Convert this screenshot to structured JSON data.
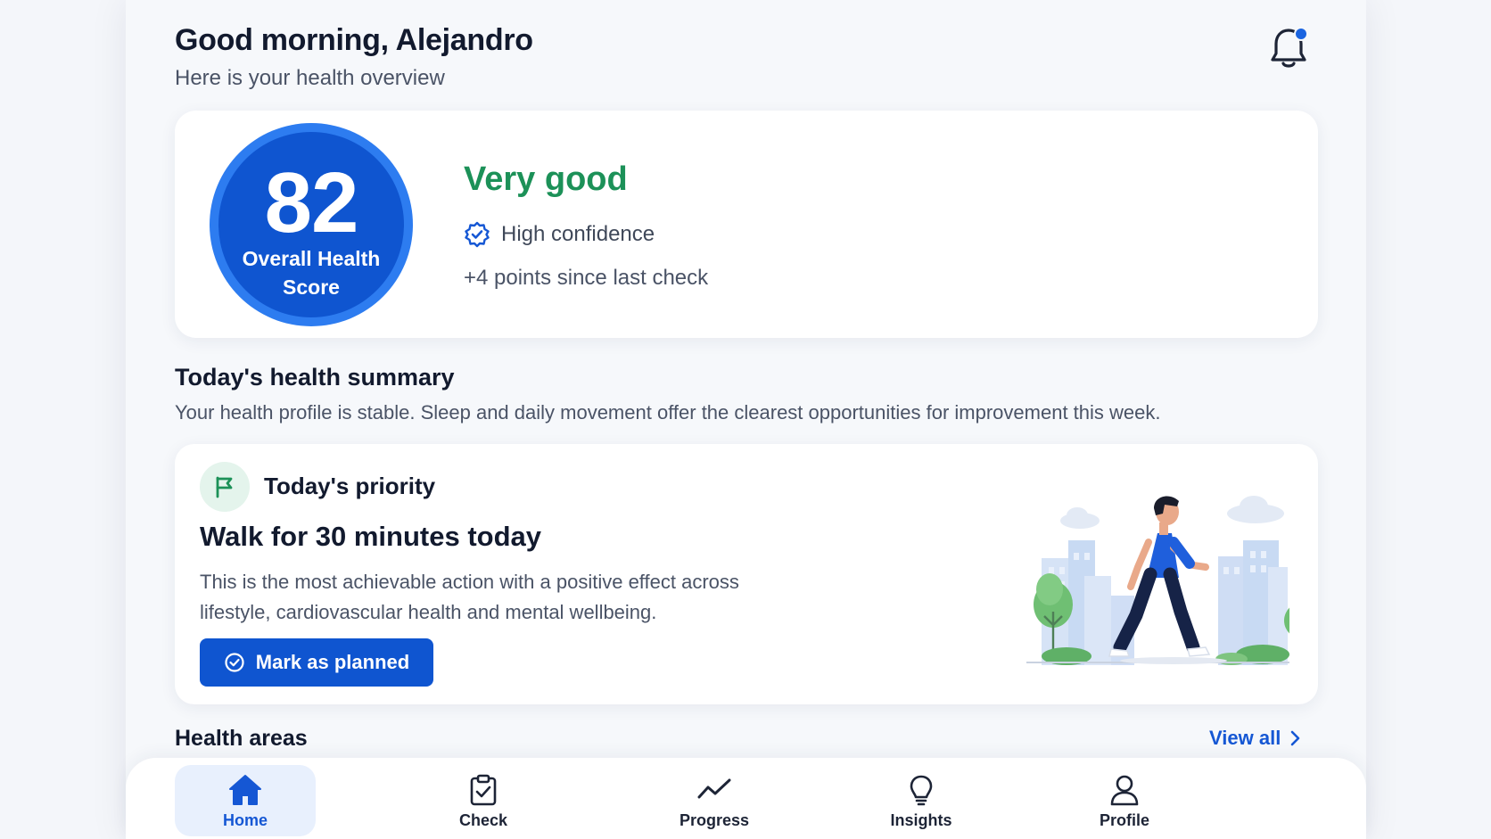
{
  "header": {
    "greeting": "Good morning, Alejandro",
    "subtitle": "Here is your health overview",
    "bell_icon": "bell-icon",
    "has_notification": true
  },
  "score": {
    "value": "82",
    "label": "Overall Health Score",
    "rating": "Very good",
    "confidence": "High confidence",
    "delta": "+4 points since last check",
    "ring_color": "#0f55d0",
    "rating_color": "#1c9158"
  },
  "summary": {
    "title": "Today's health summary",
    "text": "Your health profile is stable. Sleep and daily movement offer the clearest opportunities for improvement this week."
  },
  "priority": {
    "label": "Today's priority",
    "title": "Walk for 30 minutes today",
    "description": "This is the most achievable action with a positive effect across lifestyle, cardiovascular health and mental wellbeing.",
    "button_label": "Mark as planned",
    "icon": "flag-icon"
  },
  "areas": {
    "title": "Health areas",
    "view_all": "View all"
  },
  "nav": {
    "items": [
      {
        "label": "Home",
        "icon": "home-icon",
        "active": true
      },
      {
        "label": "Check",
        "icon": "clipboard-check-icon",
        "active": false
      },
      {
        "label": "Progress",
        "icon": "trend-line-icon",
        "active": false
      },
      {
        "label": "Insights",
        "icon": "lightbulb-icon",
        "active": false
      },
      {
        "label": "Profile",
        "icon": "user-icon",
        "active": false
      }
    ]
  },
  "colors": {
    "accent": "#0f55d0",
    "success": "#1c9158",
    "link": "#1557d4"
  }
}
